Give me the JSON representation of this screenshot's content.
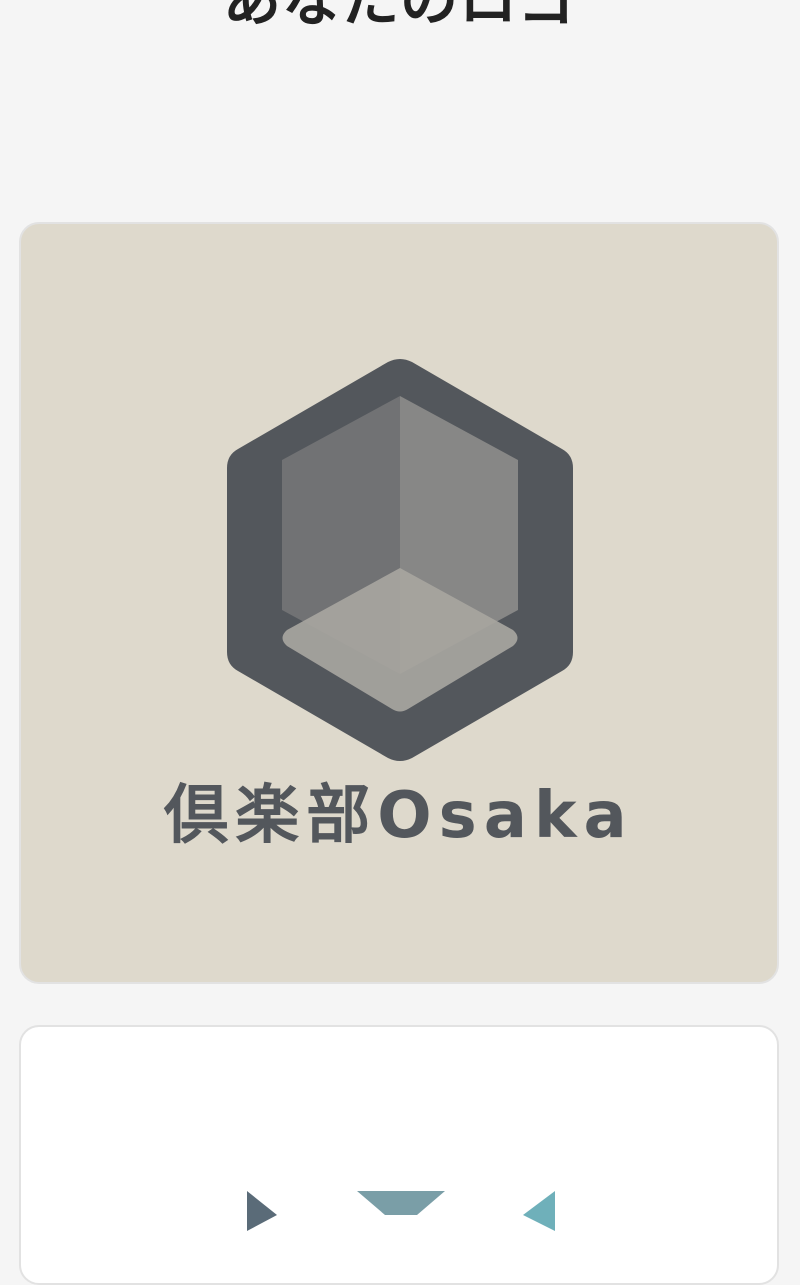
{
  "page": {
    "title": "あなたのロゴ"
  },
  "logos": [
    {
      "name": "倶楽部Osaka",
      "background": "#ded9cc",
      "colors": {
        "hexagon": "#53575c",
        "face_left": "#717274",
        "face_right": "#878786",
        "face_bottom": "#a7a59f",
        "text": "#53575c"
      },
      "icon": "hexagon-cube-icon"
    },
    {
      "name": "",
      "background": "#ffffff",
      "colors": {
        "shape_left": "#5a6b78",
        "shape_middle": "#7a9ea7",
        "shape_right": "#6fb0ba"
      },
      "icon": "geometric-mark-icon"
    }
  ]
}
